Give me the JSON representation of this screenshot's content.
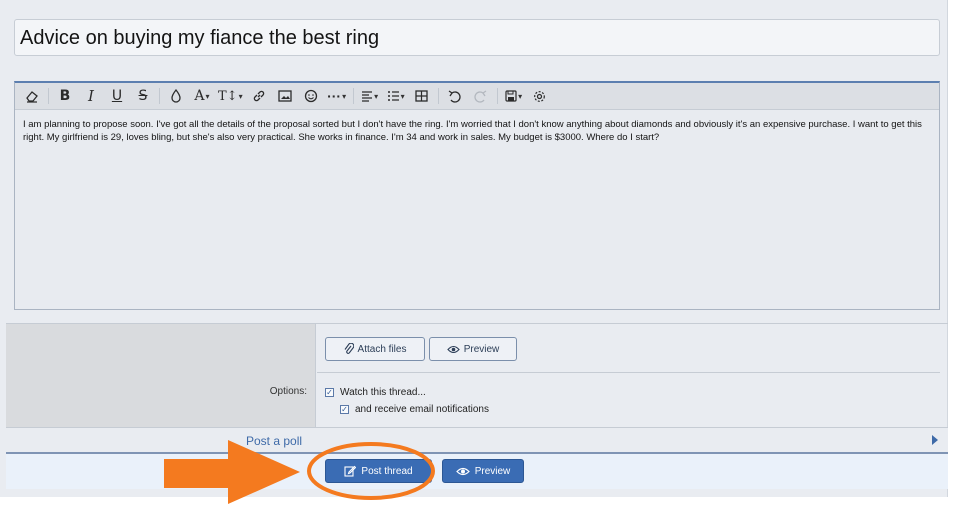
{
  "title_input": {
    "value": "Advice on buying my fiance the best ring"
  },
  "toolbar": {
    "items": [
      {
        "name": "clear-formatting-icon"
      },
      {
        "name": "bold-icon",
        "glyph": "B"
      },
      {
        "name": "italic-icon",
        "glyph": "I"
      },
      {
        "name": "underline-icon",
        "glyph": "U"
      },
      {
        "name": "strikethrough-icon",
        "glyph": "S"
      },
      {
        "name": "text-color-icon"
      },
      {
        "name": "font-family-icon",
        "glyph": "A"
      },
      {
        "name": "font-size-icon",
        "glyph": "T↕"
      },
      {
        "name": "link-icon"
      },
      {
        "name": "image-icon"
      },
      {
        "name": "smiley-icon"
      },
      {
        "name": "more-icon",
        "glyph": "···"
      },
      {
        "name": "align-icon"
      },
      {
        "name": "list-icon"
      },
      {
        "name": "table-icon"
      },
      {
        "name": "undo-icon"
      },
      {
        "name": "redo-icon"
      },
      {
        "name": "drafts-icon"
      },
      {
        "name": "settings-icon"
      }
    ]
  },
  "editor": {
    "body": "I am planning to propose soon. I've got all the details of the proposal sorted but I don't have the ring. I'm worried that I don't know anything about diamonds and obviously it's an expensive purchase. I want to get this right. My girlfriend is 29, loves bling, but she's also very practical. She works in finance. I'm 34 and work in sales. My budget is $3000. Where do I start?"
  },
  "attachments": {
    "attach_label": "Attach files",
    "preview_label": "Preview"
  },
  "options": {
    "label": "Options:",
    "watch_label": "Watch this thread...",
    "watch_checked": true,
    "email_label": "and receive email notifications",
    "email_checked": true
  },
  "poll": {
    "label": "Post a poll"
  },
  "submit": {
    "post_label": "Post thread",
    "preview_label": "Preview"
  },
  "colors": {
    "accent": "#3a6cb4",
    "highlight_annotation": "#f47a1f"
  }
}
